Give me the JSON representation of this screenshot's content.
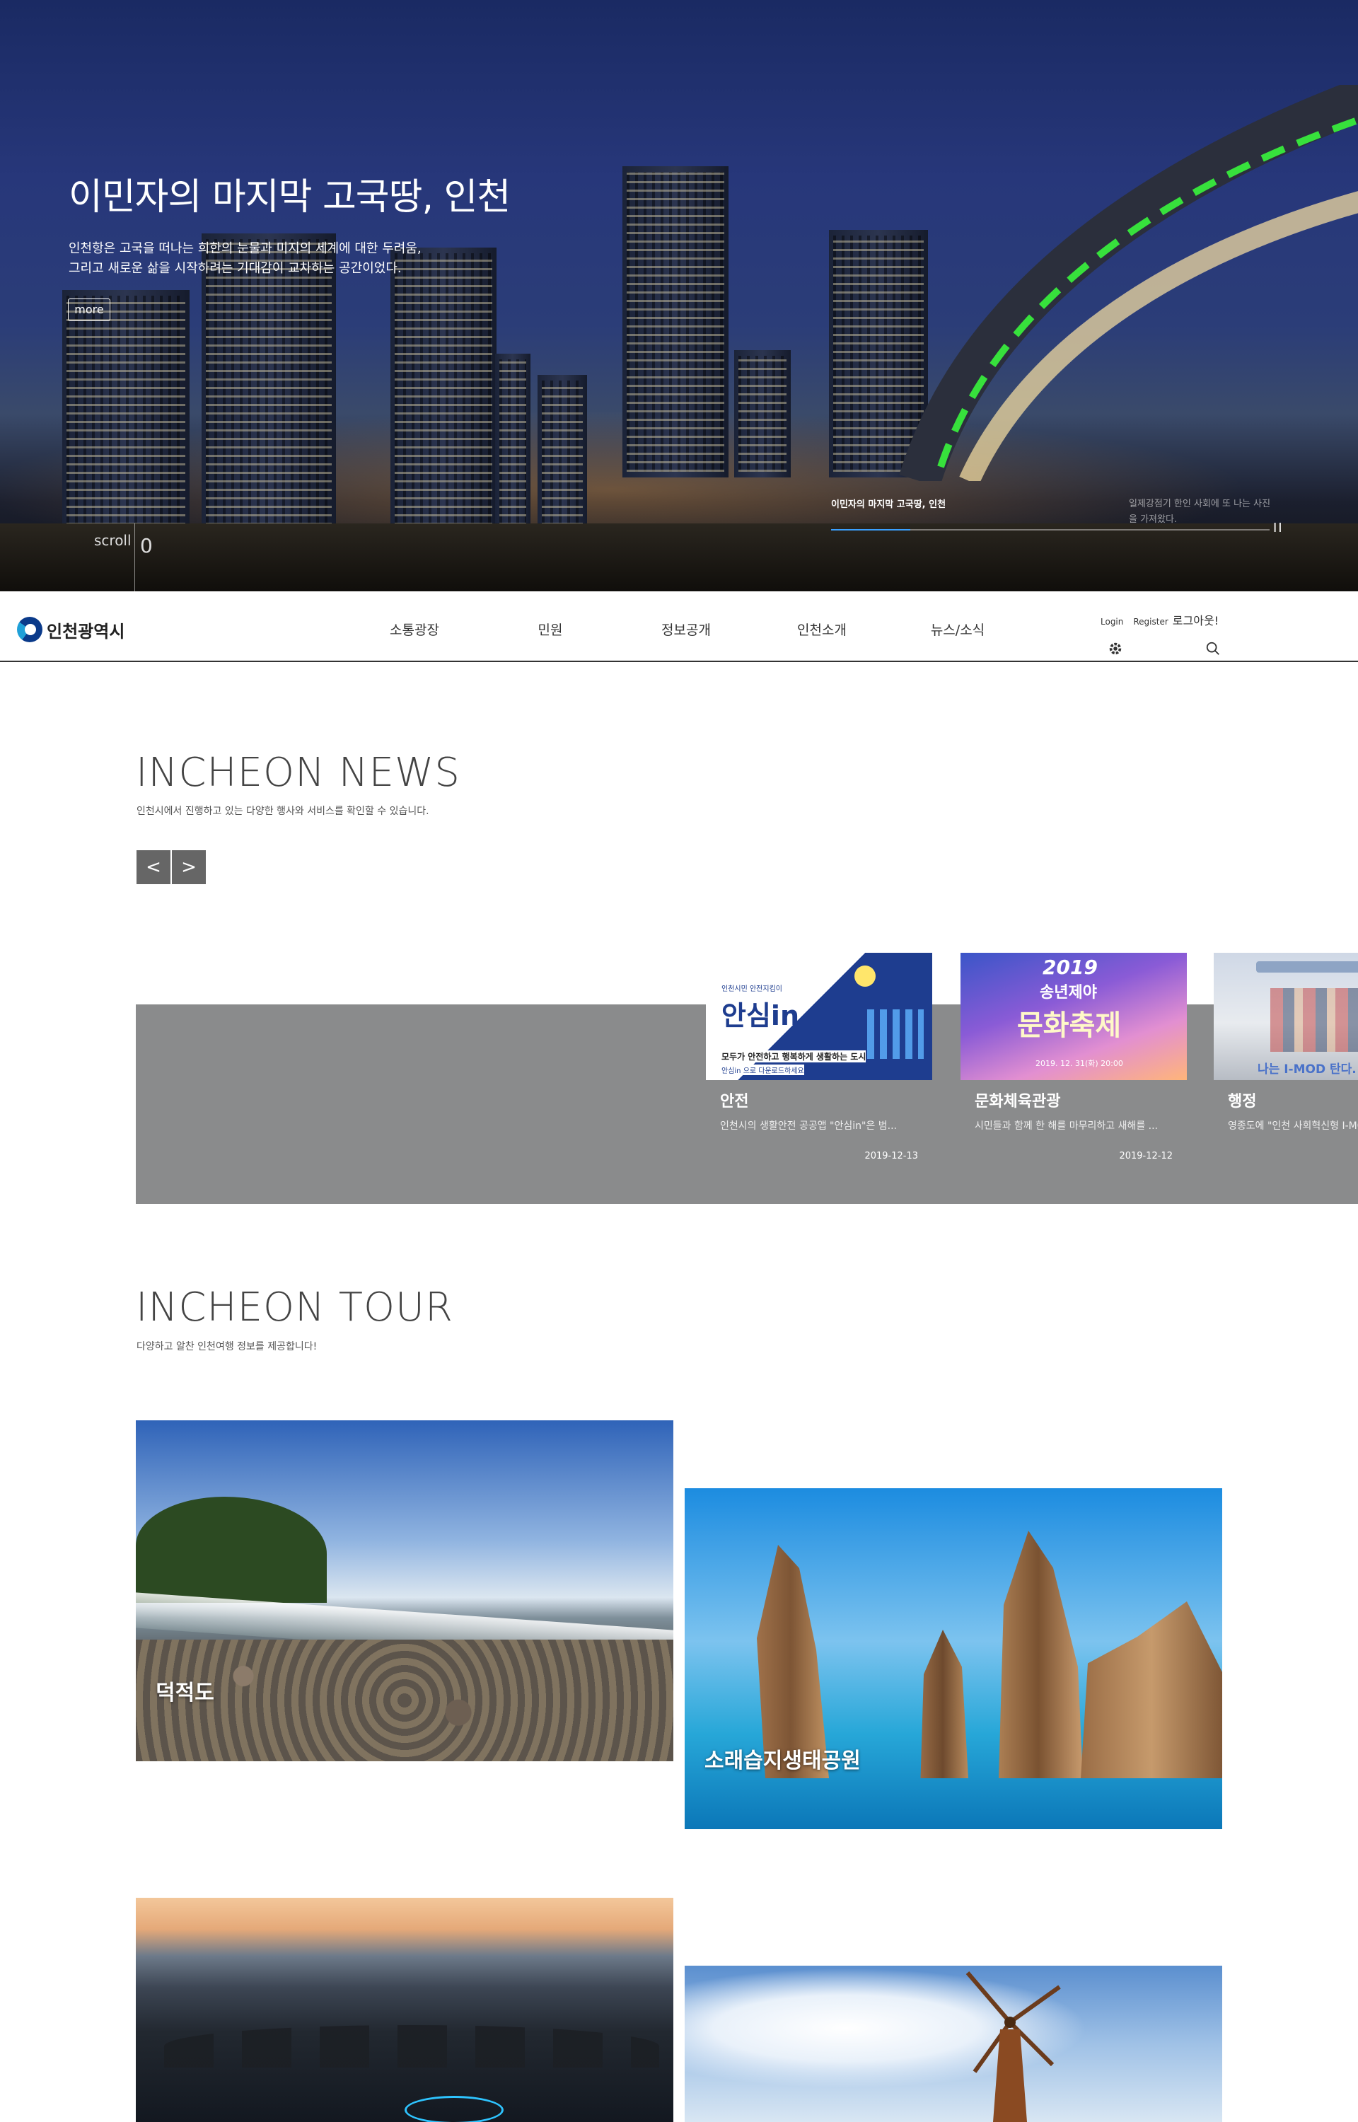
{
  "hero": {
    "title": "이민자의 마지막 고국땅, 인천",
    "desc_line1": "인천항은 고국을 떠나는 희한의 눈물과 미지의 세계에 대한 두려움,",
    "desc_line2": "그리고 새로운 삶을 시작하려는 기대감이 교차하는 공간이었다.",
    "more_label": "more",
    "scroll_label": "scroll",
    "scroll_number": "0",
    "slide_caption": "이민자의 마지막 고국땅, 인천",
    "slide_caption_next": "일제강점기 한인 사회에 또 나는 사진을 가져왔다.",
    "progress": 0.18,
    "pause_label": "II"
  },
  "header": {
    "logo_text": "인천광역시",
    "nav": [
      "소통광장",
      "민원",
      "정보공개",
      "인천소개",
      "뉴스/소식"
    ],
    "login_label": "Login",
    "register_label": "Register",
    "logout_label": "로그아웃!"
  },
  "news": {
    "title": "INCHEON NEWS",
    "desc": "인천시에서 진행하고 있는 다양한 행사와 서비스를 확인할 수 있습니다.",
    "prev_label": "<",
    "next_label": ">",
    "cards": [
      {
        "category": "안전",
        "text": "인천시의 생활안전 공공앱 \"안심in\"은 범...",
        "date": "2019-12-13",
        "thumb_title": "안심in",
        "thumb_small": "인천시민 안전지킴이",
        "thumb_line1": "모두가 안전하고 행복하게 생활하는 도시",
        "thumb_line2": "안심in 으로 다운로드하세요"
      },
      {
        "category": "문화체육관광",
        "text": "시민들과 함께 한 해를 마무리하고 새해를 ...",
        "date": "2019-12-12",
        "thumb_year": "2019",
        "thumb_title": "송년제야",
        "thumb_main": "문화축제",
        "thumb_date": "2019. 12. 31(화) 20:00"
      },
      {
        "category": "행정",
        "text": "영종도에 \"인천 사회혁신형 I-MOD\"",
        "date": "",
        "thumb_sign": "나는 I-MOD 탄다."
      }
    ]
  },
  "tour": {
    "title": "INCHEON TOUR",
    "desc": "다양하고 알찬 인천여행 정보를 제공합니다!",
    "cards": [
      {
        "label": "덕적도"
      },
      {
        "label": "소래습지생태공원"
      },
      {
        "label": ""
      },
      {
        "label": ""
      }
    ]
  }
}
